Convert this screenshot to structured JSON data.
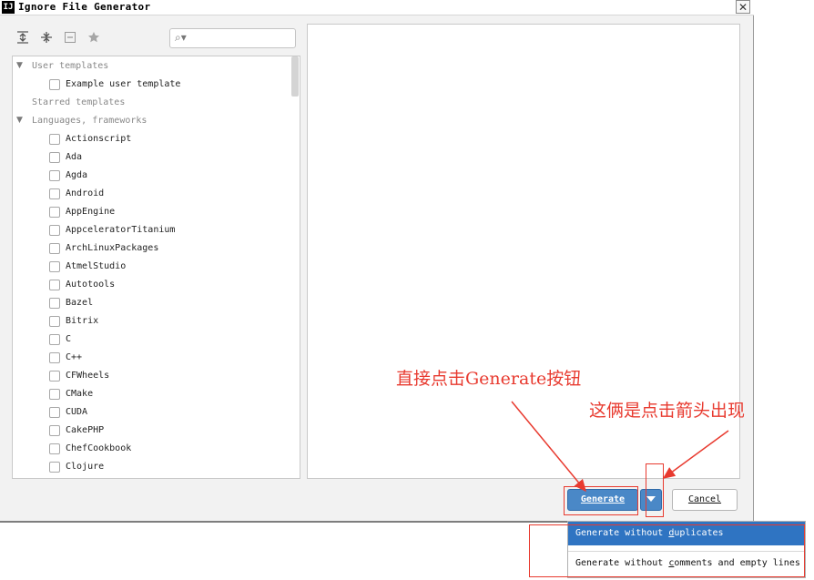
{
  "window": {
    "title": "Ignore File Generator",
    "app_icon_text": "IJ",
    "close_glyph": "✕"
  },
  "toolbar": {
    "icons": [
      "expand-all-icon",
      "collapse-all-icon",
      "remove-icon",
      "star-icon"
    ],
    "search_value": "",
    "search_placeholder": ""
  },
  "tree": {
    "user_templates_label": "User templates",
    "user_template_items": [
      "Example user template"
    ],
    "starred_label": "Starred templates",
    "languages_label": "Languages, frameworks",
    "language_items": [
      "Actionscript",
      "Ada",
      "Agda",
      "Android",
      "AppEngine",
      "AppceleratorTitanium",
      "ArchLinuxPackages",
      "AtmelStudio",
      "Autotools",
      "Bazel",
      "Bitrix",
      "C",
      "C++",
      "CFWheels",
      "CMake",
      "CUDA",
      "CakePHP",
      "ChefCookbook",
      "Clojure"
    ]
  },
  "buttons": {
    "generate_label": "Generate",
    "cancel_label": "Cancel"
  },
  "dropdown": {
    "item1": {
      "before": "Generate without ",
      "ul": "d",
      "after": "uplicates"
    },
    "item2": {
      "before": "Generate without ",
      "ul": "c",
      "after": "omments and empty lines"
    }
  },
  "annotations": {
    "click_generate": "直接点击Generate按钮",
    "arrow_shows": "这俩是点击箭头出现",
    "color": "#e83a2f"
  },
  "colors": {
    "accent": "#4a88c7",
    "menu_selected": "#2f74c2"
  }
}
